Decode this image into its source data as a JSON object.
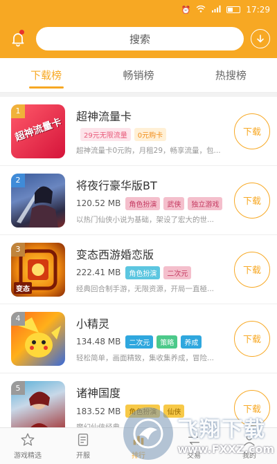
{
  "status_bar": {
    "time": "17:29"
  },
  "header": {
    "search_label": "搜索"
  },
  "tabs": [
    {
      "label": "下载榜"
    },
    {
      "label": "畅销榜"
    },
    {
      "label": "热搜榜"
    }
  ],
  "apps": [
    {
      "rank": "1",
      "name": "超神流量卡",
      "icon_text": "超神流量卡",
      "size": "",
      "tags": [
        {
          "text": "29元无限流量",
          "bg": "#fde4ea",
          "fg": "#e85a7a"
        },
        {
          "text": "0元购卡",
          "bg": "#fff0d6",
          "fg": "#f08d1a"
        }
      ],
      "desc": "超神流量卡0元购，月租29，畅享流量，包...",
      "download_label": "下载"
    },
    {
      "rank": "2",
      "name": "将夜行豪华版BT",
      "icon_text": "",
      "size": "120.52 MB",
      "tags": [
        {
          "text": "角色扮演",
          "bg": "#f4bfcc",
          "fg": "#c53a61"
        },
        {
          "text": "武侠",
          "bg": "#f4bfcc",
          "fg": "#c53a61"
        },
        {
          "text": "独立游戏",
          "bg": "#f4bfcc",
          "fg": "#c53a61"
        }
      ],
      "desc": "以热门仙侠小说为基础，架设了宏大的世...",
      "download_label": "下载"
    },
    {
      "rank": "3",
      "name": "变态西游婚恋版",
      "icon_text": "变态",
      "size": "222.41 MB",
      "tags": [
        {
          "text": "角色扮演",
          "bg": "#5cc6e0",
          "fg": "#ffffff"
        },
        {
          "text": "二次元",
          "bg": "#f4bfcc",
          "fg": "#c53a61"
        }
      ],
      "desc": "经典回合制手游，无限资源，开局一直極...",
      "download_label": "下载"
    },
    {
      "rank": "4",
      "name": "小精灵",
      "icon_text": "",
      "size": "134.48 MB",
      "tags": [
        {
          "text": "二次元",
          "bg": "#2fa7de",
          "fg": "#ffffff"
        },
        {
          "text": "策略",
          "bg": "#4cc98a",
          "fg": "#ffffff"
        },
        {
          "text": "养成",
          "bg": "#2fa7de",
          "fg": "#ffffff"
        }
      ],
      "desc": "轻松简单，画面精致，集收集养成，冒险...",
      "download_label": "下载"
    },
    {
      "rank": "5",
      "name": "诸神国度",
      "icon_text": "",
      "size": "183.52 MB",
      "tags": [
        {
          "text": "角色扮演",
          "bg": "#f7c948",
          "fg": "#9a6b00"
        },
        {
          "text": "仙侠",
          "bg": "#f7c948",
          "fg": "#9a6b00"
        }
      ],
      "desc": "魔幻仙侠经典...",
      "download_label": "下载"
    }
  ],
  "bottom_nav": [
    {
      "label": "游戏精选",
      "icon": "star-icon"
    },
    {
      "label": "开服",
      "icon": "document-icon"
    },
    {
      "label": "排行",
      "icon": "ranking-icon"
    },
    {
      "label": "交易",
      "icon": "trade-icon"
    },
    {
      "label": "我的",
      "icon": "profile-icon"
    }
  ],
  "watermark": {
    "title": "飞翔下载",
    "url": "www.FXXZ.com"
  },
  "colors": {
    "accent": "#f7a823",
    "status_bar": "#f7a823",
    "badge_red": "#e8342d"
  }
}
